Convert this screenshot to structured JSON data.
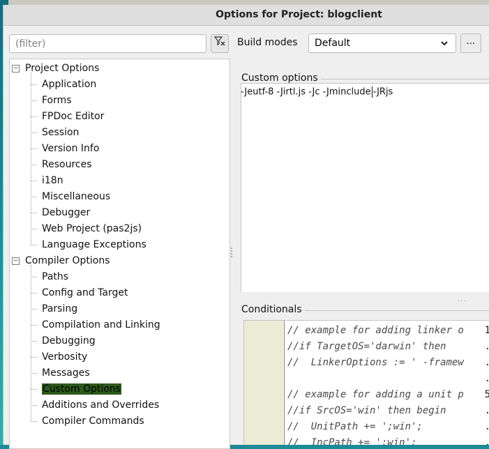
{
  "window": {
    "title": "Options for Project: blogclient"
  },
  "filter": {
    "placeholder": "(filter)"
  },
  "tree": {
    "project_options": "Project Options",
    "project_items": [
      "Application",
      "Forms",
      "FPDoc Editor",
      "Session",
      "Version Info",
      "Resources",
      "i18n",
      "Miscellaneous",
      "Debugger",
      "Web Project (pas2js)",
      "Language Exceptions"
    ],
    "compiler_options": "Compiler Options",
    "compiler_items": [
      "Paths",
      "Config and Target",
      "Parsing",
      "Compilation and Linking",
      "Debugging",
      "Verbosity",
      "Messages",
      "Custom Options",
      "Additions and Overrides",
      "Compiler Commands"
    ],
    "selected": "Custom Options"
  },
  "build_modes": {
    "label": "Build modes",
    "value": "Default",
    "more": "..."
  },
  "custom_options": {
    "label": "Custom options",
    "text_before": "-Jeutf-8 -Jirtl.js -Jc -Jminclude",
    "text_after": "-JRjs"
  },
  "conditionals": {
    "label": "Conditionals",
    "lines": [
      {
        "num": "1",
        "code": "// example for adding linker o"
      },
      {
        "num": ".",
        "code": "//if TargetOS='darwin' then"
      },
      {
        "num": ".",
        "code": "//  LinkerOptions := ' -framew"
      },
      {
        "num": ".",
        "code": ""
      },
      {
        "num": "5",
        "code": "// example for adding a unit p"
      },
      {
        "num": ".",
        "code": "//if SrcOS='win' then begin"
      },
      {
        "num": ".",
        "code": "//  UnitPath += ';win';"
      },
      {
        "num": ".",
        "code": "//  IncPath += ';win';"
      }
    ]
  },
  "colors": {
    "selection": "#2d5a1b",
    "gutter": "#ebebd6",
    "desktop": "#1e8a95"
  },
  "icons": {
    "filter_clear": "filter-clear-icon",
    "dropdown": "chevron-down-icon"
  }
}
